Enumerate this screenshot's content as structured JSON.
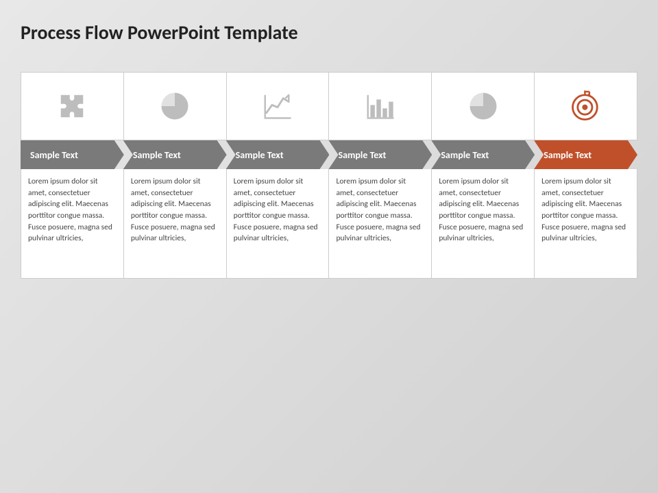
{
  "title": "Process Flow PowerPoint Template",
  "steps": [
    {
      "id": 1,
      "icon": "puzzle",
      "label": "Sample Text",
      "arrow_type": "gray-first",
      "body": "Lorem ipsum dolor sit amet, consectetuer adipiscing elit. Maecenas porttitor congue massa. Fusce posuere, magna sed pulvinar ultricies,"
    },
    {
      "id": 2,
      "icon": "pie",
      "label": "Sample Text",
      "arrow_type": "gray",
      "body": "Lorem ipsum dolor sit amet, consectetuer adipiscing elit. Maecenas porttitor congue massa. Fusce posuere, magna sed pulvinar ultricies,"
    },
    {
      "id": 3,
      "icon": "line-chart",
      "label": "Sample Text",
      "arrow_type": "gray",
      "body": "Lorem ipsum dolor sit amet, consectetuer adipiscing elit. Maecenas porttitor congue massa. Fusce posuere, magna sed pulvinar ultricies,"
    },
    {
      "id": 4,
      "icon": "bar-chart",
      "label": "Sample Text",
      "arrow_type": "gray",
      "body": "Lorem ipsum dolor sit amet, consectetuer adipiscing elit. Maecenas porttitor congue massa. Fusce posuere, magna sed pulvinar ultricies,"
    },
    {
      "id": 5,
      "icon": "pie",
      "label": "Sample Text",
      "arrow_type": "gray",
      "body": "Lorem ipsum dolor sit amet, consectetuer adipiscing elit. Maecenas porttitor congue massa. Fusce posuere, magna sed pulvinar ultricies,"
    },
    {
      "id": 6,
      "icon": "target",
      "label": "Sample Text",
      "arrow_type": "orange",
      "body": "Lorem ipsum dolor sit amet, consectetuer adipiscing elit. Maecenas porttitor congue massa. Fusce posuere, magna sed pulvinar ultricies,"
    }
  ]
}
